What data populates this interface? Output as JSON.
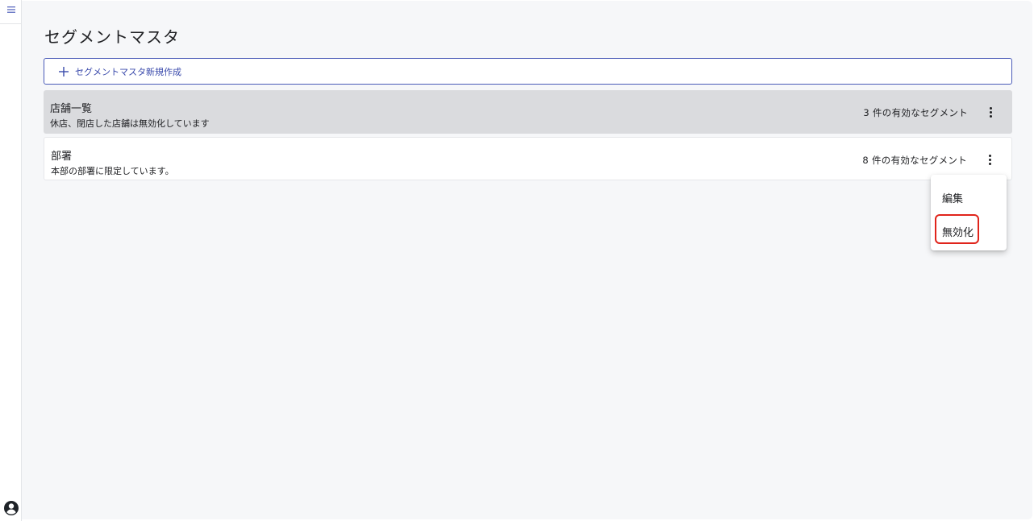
{
  "page": {
    "title": "セグメントマスタ"
  },
  "toolbar": {
    "add_label": "セグメントマスタ新規作成"
  },
  "segments": [
    {
      "title": "店舗一覧",
      "description": "休店、閉店した店舗は無効化しています",
      "count_text": "3 件の有効なセグメント",
      "highlighted": true
    },
    {
      "title": "部署",
      "description": "本部の部署に限定しています。",
      "count_text": "8 件の有効なセグメント",
      "highlighted": false
    }
  ],
  "context_menu": {
    "items": [
      {
        "label": "編集"
      },
      {
        "label": "無効化",
        "emphasized": true
      }
    ]
  },
  "icons": {
    "rail_top": "hamburger-menu-icon",
    "rail_bottom": "user-circle-icon",
    "add": "plus-icon",
    "row_action": "more-vertical-icon"
  },
  "colors": {
    "accent": "#3949ab",
    "emphasis_outline": "#e0241b",
    "highlight_row": "#dadbde"
  }
}
